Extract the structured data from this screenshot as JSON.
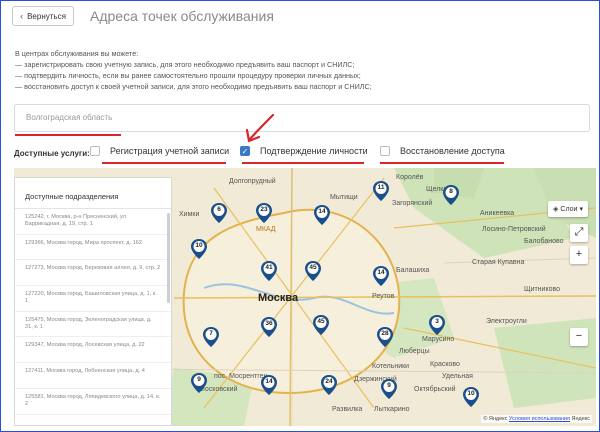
{
  "header": {
    "back_label": "Вернуться",
    "title": "Адреса точек обслуживания"
  },
  "intro": {
    "lead": "В центрах обслуживания вы можете:",
    "items": [
      "— зарегистрировать свою учетную запись, для этого необходимо предъявить ваш паспорт и СНИЛС;",
      "— подтвердить личность, если вы ранее самостоятельно прошли процедуру проверки личных данных;",
      "— восстановить доступ к своей учетной записи, для этого необходимо предъявить ваш паспорт и СНИЛС;"
    ]
  },
  "region": {
    "value": "Волгоградская область"
  },
  "services": {
    "label": "Доступные услуги:",
    "items": [
      {
        "label": "Регистрация учетной записи",
        "checked": false
      },
      {
        "label": "Подтверждение личности",
        "checked": true
      },
      {
        "label": "Восстановление доступа",
        "checked": false
      }
    ]
  },
  "panel": {
    "title": "Доступные подразделения",
    "items": [
      "125242, г. Москва, р-н Пресненский, ул. Баррикадная, д. 19, стр. 1",
      "129366, Москва город, Мира проспект, д. 162",
      "127273, Москва город, Березовая аллея, д. 9, стр. 2",
      "127220, Москва город, Башиловская улица, д. 1, к. 1",
      "125475, Москва город, Зеленоградская улица, д. 31, к. 1",
      "129347, Москва город, Лосевская улица, д. 22",
      "127411, Москва город, Лобненская улица, д. 4",
      "125581, Москва город, Ляпидевского улица, д. 14, к. 2"
    ]
  },
  "map": {
    "layers_label": "Слои",
    "copyright": "© Яндекс",
    "terms_label": "Условия использования",
    "brand": "Яндекс",
    "labels": {
      "moscow": "Москва",
      "dolgoprudny": "Долгопрудный",
      "mytishchi": "Мытищи",
      "korolev": "Королёв",
      "shchelkovo": "Щелково",
      "losino": "Лосино-Петровский",
      "balashikha": "Балашиха",
      "reutov": "Реутов",
      "staraya_kupavna": "Старая Купавна",
      "elektrougli": "Электроугли",
      "lyubertsy": "Люберцы",
      "kotelniki": "Котельники",
      "dzerzhinsky": "Дзержинский",
      "lytkarino": "Лыткарино",
      "oktyabrsky": "Октябрьский",
      "udelnaya": "Удельная",
      "marusino": "Марусино",
      "kraskovo": "Красково",
      "moskovsky": "Московский",
      "mosrentgen": "пос. Мосрентген",
      "razvilka": "Развилка",
      "zagoryansky": "Загорянский",
      "anikeevka": "Аникеевка",
      "balobanovo": "Балобаново",
      "shchitnikovo": "Щитниково",
      "khimki": "Химки",
      "mkad": "МКАД"
    },
    "markers": [
      "6",
      "23",
      "14",
      "11",
      "8",
      "10",
      "41",
      "45",
      "14",
      "7",
      "36",
      "45",
      "28",
      "3",
      "9",
      "14",
      "24",
      "9",
      "10"
    ]
  },
  "colors": {
    "accent": "#3a79c4",
    "marker": "#1a4f8c",
    "underline": "#d9262b",
    "frame": "#2a4fd6"
  }
}
